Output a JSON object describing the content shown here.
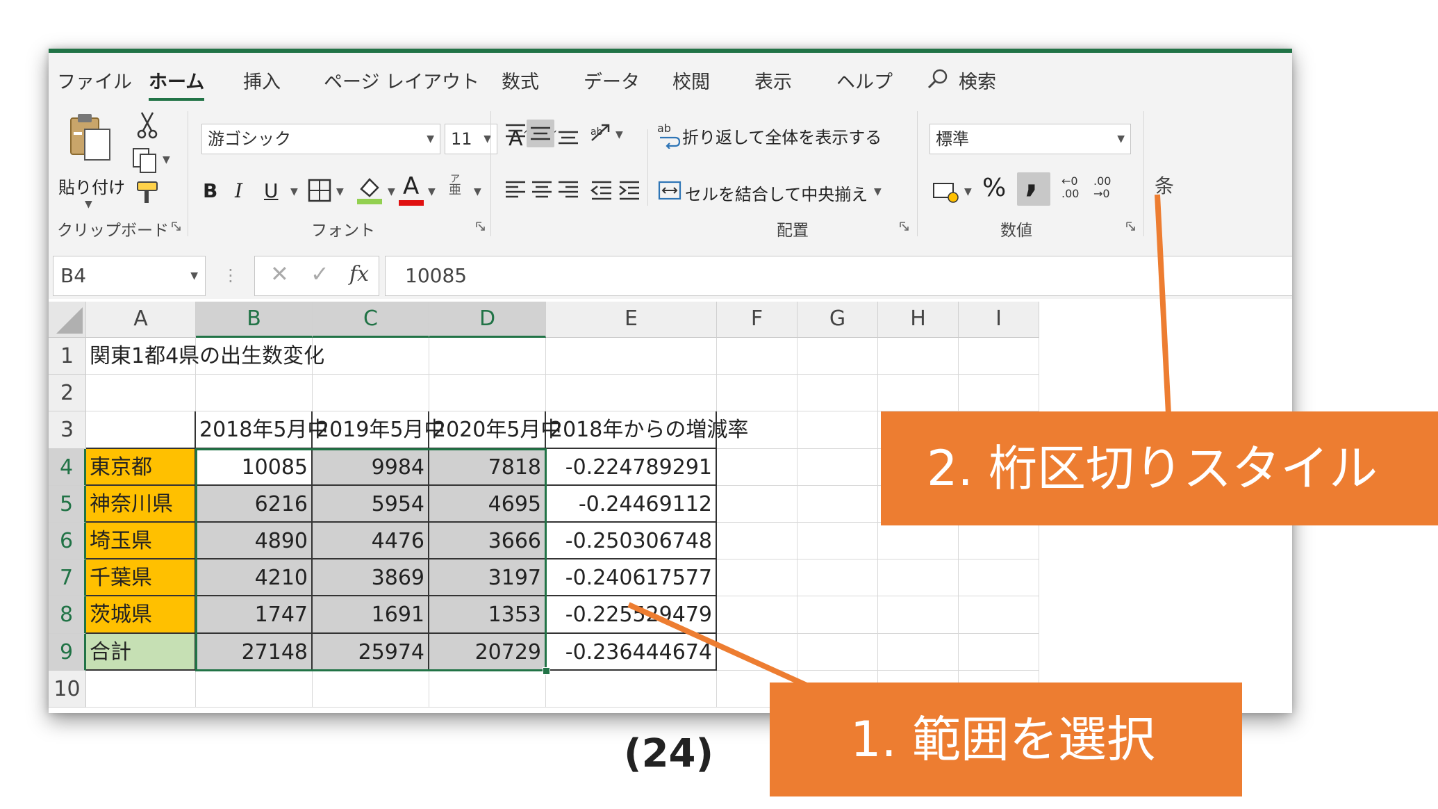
{
  "tabs": [
    "ファイル",
    "ホーム",
    "挿入",
    "ページ レイアウト",
    "数式",
    "データ",
    "校閲",
    "表示",
    "ヘルプ"
  ],
  "search_label": "検索",
  "clipboard": {
    "paste_label": "貼り付け",
    "group_label": "クリップボード"
  },
  "font": {
    "name": "游ゴシック",
    "size": "11",
    "group_label": "フォント",
    "bold": "B",
    "italic": "I",
    "underline": "U",
    "font_color_letter": "A",
    "phonetic_top": "ア",
    "phonetic_bottom": "亜",
    "grow": "A",
    "shrink": "A"
  },
  "alignment": {
    "wrap_text": "折り返して全体を表示する",
    "merge_center": "セルを結合して中央揃え",
    "group_label": "配置"
  },
  "number": {
    "format": "標準",
    "group_label": "数値",
    "percent": "%",
    "comma": ",",
    "inc_decimal_top": "←0",
    "inc_decimal_bottom": ".00",
    "dec_decimal_top": ".00",
    "dec_decimal_bottom": "→0"
  },
  "styles_partial": "条",
  "formula_bar": {
    "name_box": "B4",
    "fx": "fx",
    "value": "10085"
  },
  "colors": {
    "excel_green": "#217346",
    "prefecture_fill": "#ffc000",
    "total_fill": "#c6e0b4",
    "callout_orange": "#ed7d31",
    "selection_gray": "#d0d0d0"
  },
  "grid": {
    "columns": [
      "A",
      "B",
      "C",
      "D",
      "E",
      "F",
      "G",
      "H",
      "I"
    ],
    "rows": [
      "1",
      "2",
      "3",
      "4",
      "5",
      "6",
      "7",
      "8",
      "9",
      "10"
    ],
    "title": "関東1都4県の出生数変化",
    "headers": [
      "2018年5月中",
      "2019年5月中",
      "2020年5月中",
      "2018年からの増減率"
    ],
    "data": [
      {
        "pref": "東京都",
        "y2018": "10085",
        "y2019": "9984",
        "y2020": "7818",
        "rate": "-0.224789291"
      },
      {
        "pref": "神奈川県",
        "y2018": "6216",
        "y2019": "5954",
        "y2020": "4695",
        "rate": "-0.24469112"
      },
      {
        "pref": "埼玉県",
        "y2018": "4890",
        "y2019": "4476",
        "y2020": "3666",
        "rate": "-0.250306748"
      },
      {
        "pref": "千葉県",
        "y2018": "4210",
        "y2019": "3869",
        "y2020": "3197",
        "rate": "-0.240617577"
      },
      {
        "pref": "茨城県",
        "y2018": "1747",
        "y2019": "1691",
        "y2020": "1353",
        "rate": "-0.225529479"
      },
      {
        "pref": "合計",
        "y2018": "27148",
        "y2019": "25974",
        "y2020": "20729",
        "rate": "-0.236444674"
      }
    ]
  },
  "annotations": {
    "step1": "1. 範囲を選択",
    "step2": "2. 桁区切りスタイル"
  },
  "page_label": "(24)"
}
